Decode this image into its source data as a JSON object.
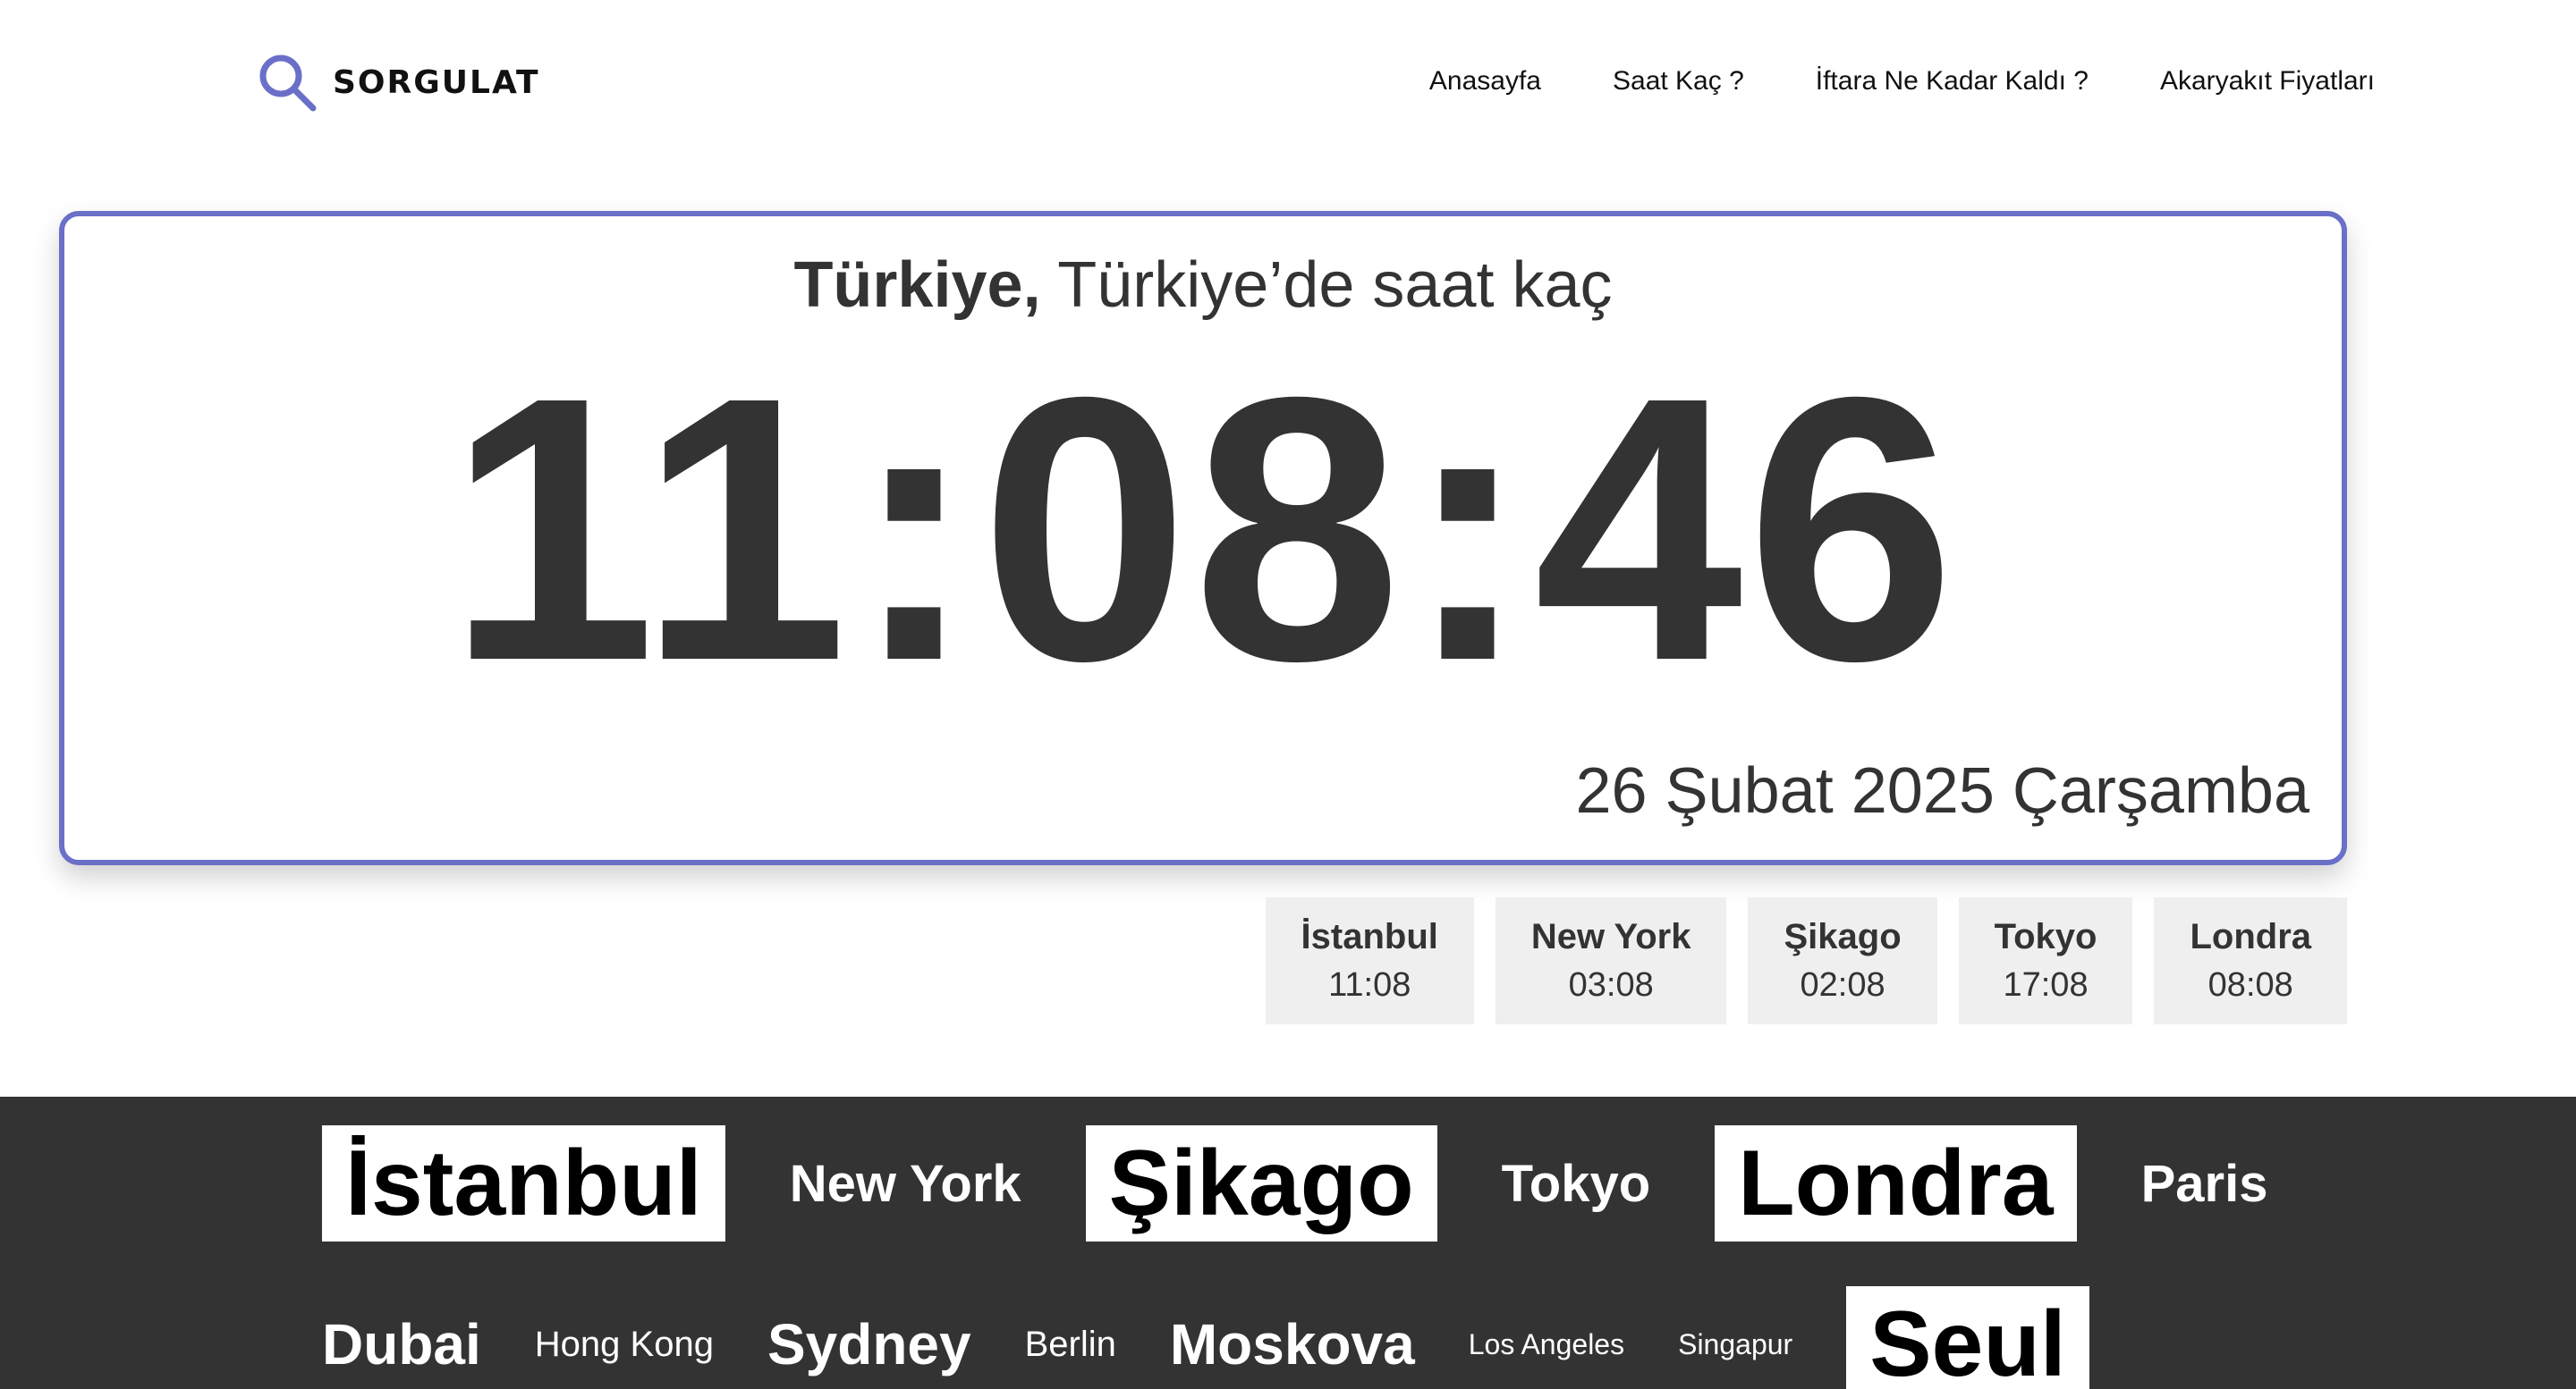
{
  "header": {
    "logo_text": "SORGULAT",
    "nav": [
      {
        "label": "Anasayfa"
      },
      {
        "label": "Saat Kaç ?"
      },
      {
        "label": "İftara Ne Kadar Kaldı ?"
      },
      {
        "label": "Akaryakıt Fiyatları"
      }
    ]
  },
  "clock": {
    "heading_strong": "Türkiye,",
    "heading_rest": " Türkiye’de saat kaç",
    "time": "11:08:46",
    "date": "26 Şubat 2025 Çarşamba"
  },
  "world_clocks": [
    {
      "city": "İstanbul",
      "time": "11:08"
    },
    {
      "city": "New York",
      "time": "03:08"
    },
    {
      "city": "Şikago",
      "time": "02:08"
    },
    {
      "city": "Tokyo",
      "time": "17:08"
    },
    {
      "city": "Londra",
      "time": "08:08"
    }
  ],
  "city_links": {
    "row1": [
      "İstanbul",
      "New York",
      "Şikago",
      "Tokyo",
      "Londra",
      "Paris"
    ],
    "row2": [
      "Dubai",
      "Hong Kong",
      "Sydney",
      "Berlin",
      "Moskova",
      "Los Angeles",
      "Singapur",
      "Seul"
    ]
  },
  "colors": {
    "accent": "#6a6fc8",
    "band_background": "#333333",
    "text": "#333333",
    "chip_background": "#efefef"
  }
}
